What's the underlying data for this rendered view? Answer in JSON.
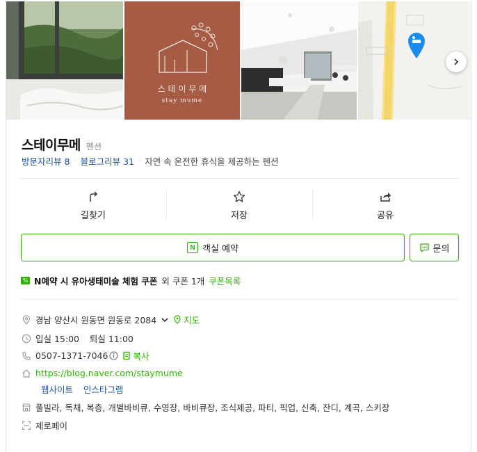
{
  "listing": {
    "name": "스테이무메",
    "category": "펜션",
    "visitor_reviews": "방문자리뷰 8",
    "blog_reviews": "블로그리뷰 31",
    "tagline": "자연 속 온전한 휴식을 제공하는 펜션"
  },
  "photos": {
    "logo_text_main": "스 테 이 무 메",
    "logo_text_sub": "stay mume"
  },
  "actions": {
    "directions": "길찾기",
    "save": "저장",
    "share": "공유"
  },
  "booking": {
    "reserve_label": "객실 예약",
    "inquiry_label": "문의",
    "naver_logo": "N"
  },
  "coupon": {
    "badge": "%",
    "text_bold": "N예약 시 유아생태미술 체험 쿠폰",
    "text_rest": "외 쿠폰 1개",
    "link": "쿠폰목록"
  },
  "info": {
    "address": "경남 양산시 원동면 원동로 2084",
    "map_link": "지도",
    "checkin": "입실 15:00",
    "checkout": "퇴실 11:00",
    "phone": "0507-1371-7046",
    "copy_label": "복사",
    "url": "https://blog.naver.com/staymume",
    "website_link": "웹사이트",
    "instagram_link": "인스타그램",
    "amenities": "풀빌라, 독채, 복층, 개별바비큐, 수영장, 바비큐장, 조식제공, 파티, 픽업, 신축, 잔디, 계곡, 스키장",
    "payment": "제로페이"
  },
  "colors": {
    "naver_green": "#2db400",
    "link_blue": "#1a4fa0",
    "brand_brown": "#a55b44"
  }
}
